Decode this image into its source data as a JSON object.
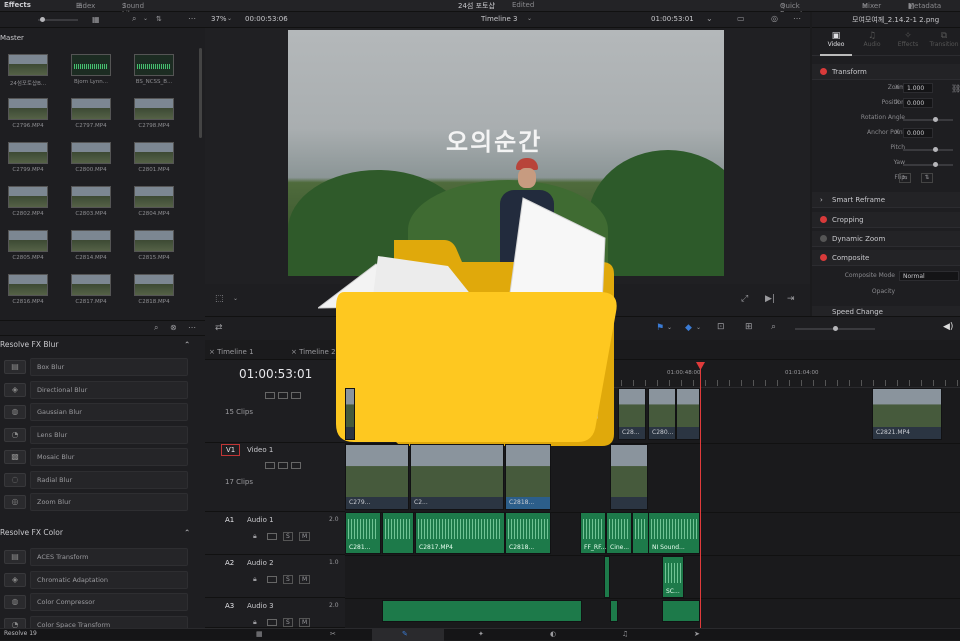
{
  "topbar": {
    "effects": "Effects",
    "index": "Index",
    "sound_library": "Sound Library",
    "project": "24섬 포토샵",
    "status": "Edited",
    "quick_export": "Quick Export",
    "mixer": "Mixer",
    "metadata": "Metadata"
  },
  "viewer_bar": {
    "zoom": "37%",
    "src_tc": "00:00:53:06",
    "timeline": "Timeline 3",
    "rec_tc": "01:00:53:01",
    "filename": "모여모여께_2.14.2-1 2.png"
  },
  "media_pool": {
    "bin": "Master",
    "items": [
      {
        "label": "24섬포토샵B...",
        "type": "video"
      },
      {
        "label": "Bjorn Lynn...",
        "type": "audio"
      },
      {
        "label": "BS_NCSS_B...",
        "type": "audio"
      },
      {
        "label": "C2796.MP4",
        "type": "video"
      },
      {
        "label": "C2797.MP4",
        "type": "video"
      },
      {
        "label": "C2798.MP4",
        "type": "video"
      },
      {
        "label": "C2799.MP4",
        "type": "video"
      },
      {
        "label": "C2800.MP4",
        "type": "video"
      },
      {
        "label": "C2801.MP4",
        "type": "video"
      },
      {
        "label": "C2802.MP4",
        "type": "video"
      },
      {
        "label": "C2803.MP4",
        "type": "video"
      },
      {
        "label": "C2804.MP4",
        "type": "video"
      },
      {
        "label": "C2805.MP4",
        "type": "video"
      },
      {
        "label": "C2814.MP4",
        "type": "video"
      },
      {
        "label": "C2815.MP4",
        "type": "video"
      },
      {
        "label": "C2816.MP4",
        "type": "video"
      },
      {
        "label": "C2817.MP4",
        "type": "video"
      },
      {
        "label": "C2818.MP4",
        "type": "video"
      }
    ]
  },
  "effects": {
    "blur_title": "Resolve FX Blur",
    "blur": [
      "Box Blur",
      "Directional Blur",
      "Gaussian Blur",
      "Lens Blur",
      "Mosaic Blur",
      "Radial Blur",
      "Zoom Blur"
    ],
    "color_title": "Resolve FX Color",
    "color": [
      "ACES Transform",
      "Chromatic Adaptation",
      "Color Compressor",
      "Color Space Transform"
    ]
  },
  "viewer": {
    "caption": "오의순간"
  },
  "inspector": {
    "tabs": [
      "Video",
      "Audio",
      "Effects",
      "Transition"
    ],
    "transform": "Transform",
    "zoom_label": "Zoom",
    "zoom_val": "1.000",
    "position_label": "Position",
    "position_val": "0.000",
    "rotation_label": "Rotation Angle",
    "anchor_label": "Anchor Point",
    "anchor_val": "0.000",
    "pitch_label": "Pitch",
    "yaw_label": "Yaw",
    "flip_label": "Flip",
    "axis_x": "X",
    "smart_reframe": "Smart Reframe",
    "cropping": "Cropping",
    "dynamic_zoom": "Dynamic Zoom",
    "composite": "Composite",
    "composite_mode_label": "Composite Mode",
    "composite_mode_val": "Normal",
    "opacity_label": "Opacity",
    "speed_change": "Speed Change"
  },
  "timeline": {
    "tabs": [
      "Timeline 1",
      "Timeline 2"
    ],
    "timecode": "01:00:53:01",
    "ruler": [
      "01:00:48:00",
      "01:01:04:00"
    ],
    "tracks": [
      {
        "id": "",
        "name": "",
        "clips": "15 Clips"
      },
      {
        "id": "V1",
        "name": "Video 1",
        "clips": "17 Clips"
      },
      {
        "id": "A1",
        "name": "Audio 1",
        "level": "2.0"
      },
      {
        "id": "A2",
        "name": "Audio 2",
        "level": "1.0"
      },
      {
        "id": "A3",
        "name": "Audio 3",
        "level": "2.0"
      }
    ],
    "video_clips": [
      "C279...",
      "C2...",
      "C2818...",
      "C28...",
      "C280...",
      "C2...",
      "C2821.MP4"
    ],
    "audio_clips": [
      "C281...",
      "C2817.MP4",
      "C2818...",
      "FF_RF...",
      "Cine...",
      "NI Sound...",
      "SC..."
    ]
  },
  "bottombar": {
    "version": "Resolve 19"
  }
}
